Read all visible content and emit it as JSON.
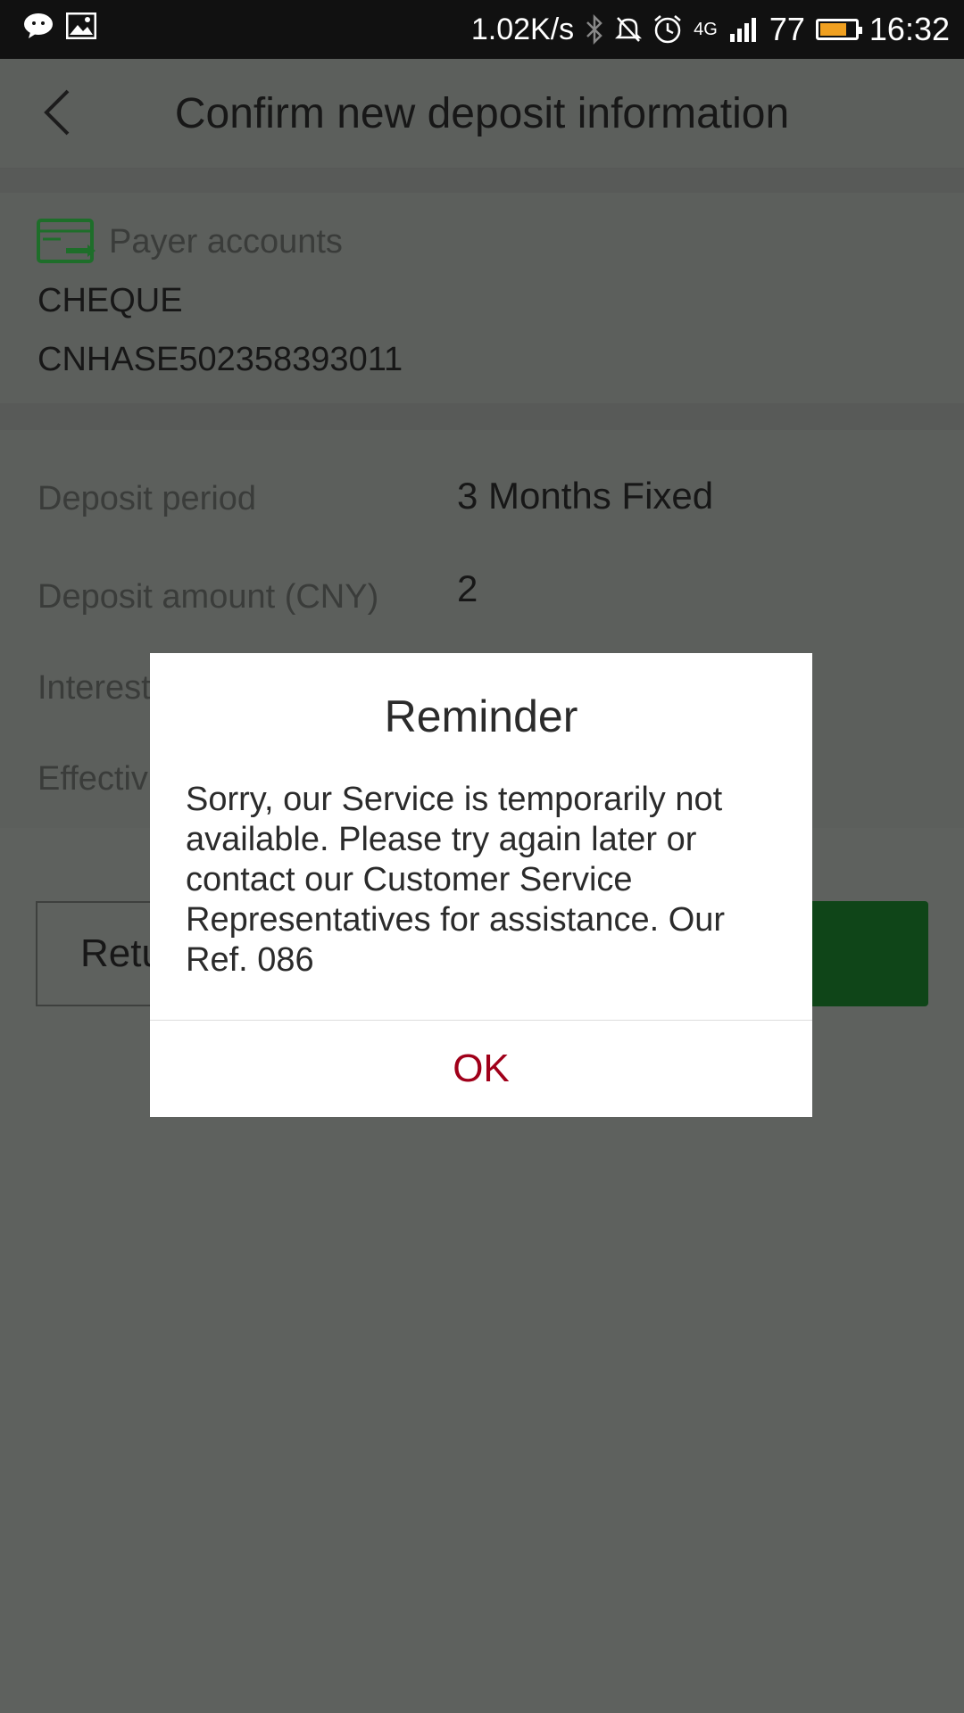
{
  "status_bar": {
    "speed": "1.02K/s",
    "network": "4G",
    "battery_level": "77",
    "time": "16:32",
    "icons": [
      "chat-icon",
      "image-icon",
      "bluetooth-icon",
      "mute-icon",
      "alarm-icon",
      "signal-icon",
      "battery-icon"
    ]
  },
  "header": {
    "title": "Confirm new deposit information",
    "back_icon": "chevron-left-icon"
  },
  "payer": {
    "section_title": "Payer accounts",
    "account_type": "CHEQUE",
    "account_number": "CNHASE502358393011",
    "icon": "card-transfer-icon"
  },
  "details": [
    {
      "label": "Deposit period",
      "value": "3 Months Fixed"
    },
    {
      "label": "Deposit amount (CNY)",
      "value": "2"
    },
    {
      "label": "Interest",
      "value": ""
    },
    {
      "label": "Effectiv",
      "value": ""
    }
  ],
  "buttons": {
    "return_label": "Retu",
    "confirm_label": ""
  },
  "dialog": {
    "title": "Reminder",
    "message": "Sorry, our Service is temporarily not available. Please try again later or contact our Customer Service Representatives for assistance. Our Ref. 086",
    "ok_label": "OK"
  },
  "colors": {
    "accent_green": "#1e7a2e",
    "ok_red": "#a0001a",
    "overlay": "#5e615e"
  }
}
